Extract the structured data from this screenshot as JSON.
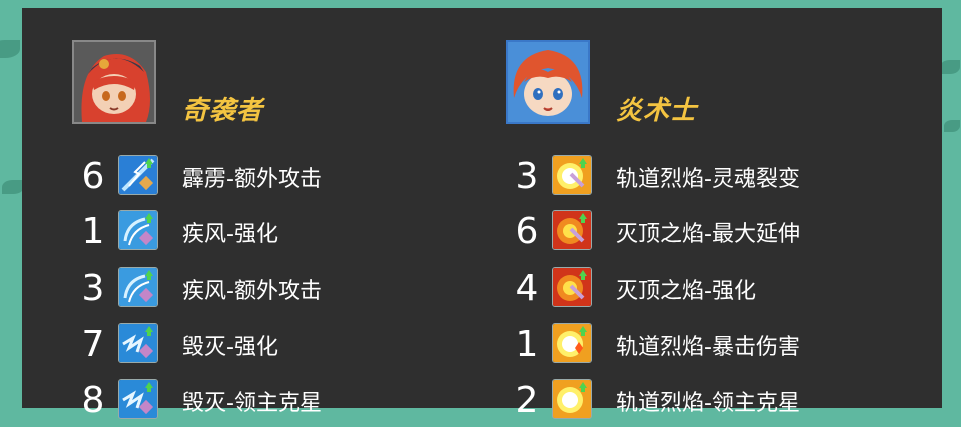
{
  "left_job": {
    "name": "奇袭者",
    "avatar_icon": "redhair-pirate-avatar-icon",
    "skills": [
      {
        "count": "6",
        "label": "霹雳-额外攻击",
        "icon": "thunder-skill-icon"
      },
      {
        "count": "1",
        "label": "疾风-强化",
        "icon": "wind-skill-icon"
      },
      {
        "count": "3",
        "label": "疾风-额外攻击",
        "icon": "wind-skill-icon"
      },
      {
        "count": "7",
        "label": "毁灭-强化",
        "icon": "destroy-skill-icon"
      },
      {
        "count": "8",
        "label": "毁灭-领主克星",
        "icon": "destroy-skill-icon"
      }
    ]
  },
  "right_job": {
    "name": "炎术士",
    "avatar_icon": "redhair-mage-avatar-icon",
    "skills": [
      {
        "count": "3",
        "label": "轨道烈焰-灵魂裂变",
        "icon": "orbital-flame-skill-icon"
      },
      {
        "count": "6",
        "label": "灭顶之焰-最大延伸",
        "icon": "inferno-skill-icon"
      },
      {
        "count": "4",
        "label": "灭顶之焰-强化",
        "icon": "inferno-skill-icon"
      },
      {
        "count": "1",
        "label": "轨道烈焰-暴击伤害",
        "icon": "orbital-flame-skill-icon"
      },
      {
        "count": "2",
        "label": "轨道烈焰-领主克星",
        "icon": "orbital-flame-skill-icon"
      }
    ]
  },
  "colors": {
    "title": "#f4c441",
    "panel": "#2f2f2f",
    "background": "#5fb8a0"
  }
}
